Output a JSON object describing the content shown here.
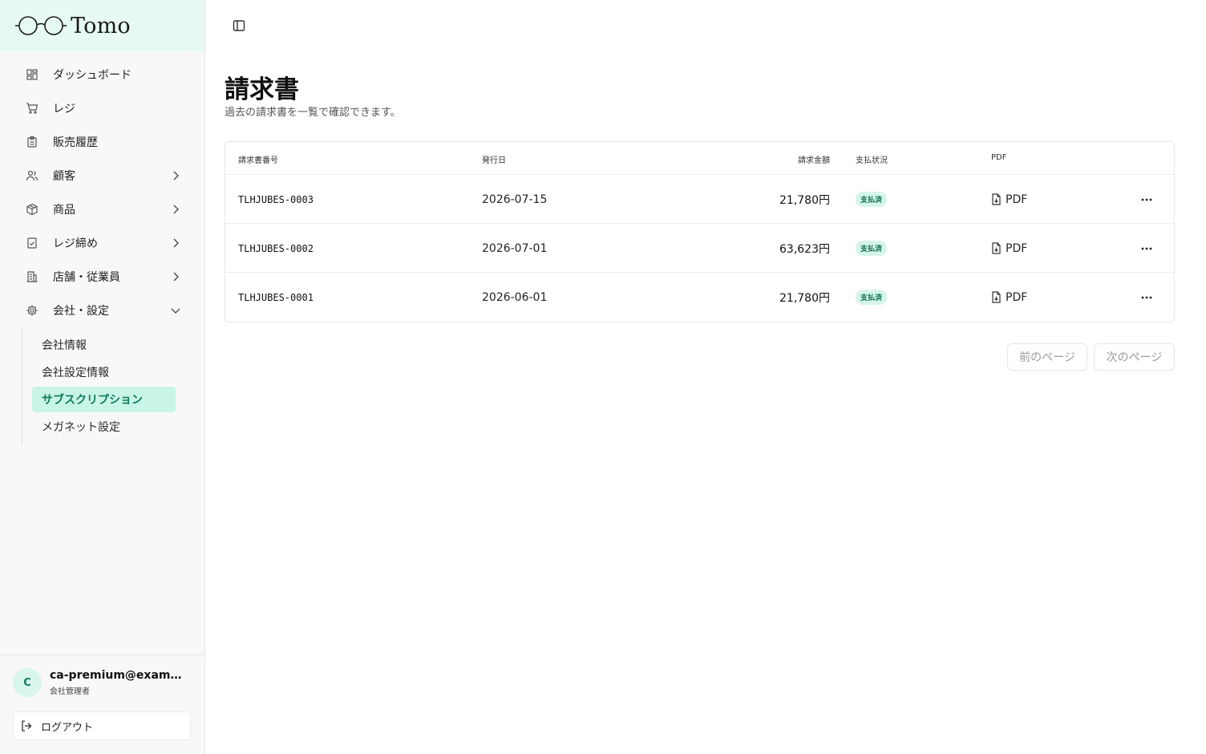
{
  "brand": {
    "name": "Tomo"
  },
  "sidebar": {
    "items": [
      {
        "label": "ダッシュボード",
        "icon": "dashboard-icon"
      },
      {
        "label": "レジ",
        "icon": "cart-icon"
      },
      {
        "label": "販売履歴",
        "icon": "clipboard-icon"
      },
      {
        "label": "顧客",
        "icon": "users-icon"
      },
      {
        "label": "商品",
        "icon": "package-icon"
      },
      {
        "label": "レジ締め",
        "icon": "checklist-icon"
      },
      {
        "label": "店舗・従業員",
        "icon": "building-icon"
      },
      {
        "label": "会社・設定",
        "icon": "gear-icon"
      }
    ],
    "subitems": [
      {
        "label": "会社情報"
      },
      {
        "label": "会社設定情報"
      },
      {
        "label": "サブスクリプション"
      },
      {
        "label": "メガネット設定"
      }
    ]
  },
  "user": {
    "initial": "C",
    "email": "ca-premium@example.com",
    "role": "会社管理者",
    "logout_label": "ログアウト"
  },
  "page": {
    "title": "請求書",
    "subtitle": "過去の請求書を一覧で確認できます。"
  },
  "table": {
    "headers": {
      "number": "請求書番号",
      "date": "発行日",
      "amount": "請求金額",
      "status": "支払状況",
      "pdf": "PDF"
    },
    "rows": [
      {
        "number": "TLHJUBES-0003",
        "date": "2026-07-15",
        "amount": "21,780円",
        "status": "支払済",
        "pdf": "PDF"
      },
      {
        "number": "TLHJUBES-0002",
        "date": "2026-07-01",
        "amount": "63,623円",
        "status": "支払済",
        "pdf": "PDF"
      },
      {
        "number": "TLHJUBES-0001",
        "date": "2026-06-01",
        "amount": "21,780円",
        "status": "支払済",
        "pdf": "PDF"
      }
    ]
  },
  "pagination": {
    "prev_label": "前のページ",
    "next_label": "次のページ"
  },
  "colors": {
    "accent": "#0d7a5c",
    "accent_bg": "#c9f5e6",
    "brand_bg": "#e6faf3"
  }
}
